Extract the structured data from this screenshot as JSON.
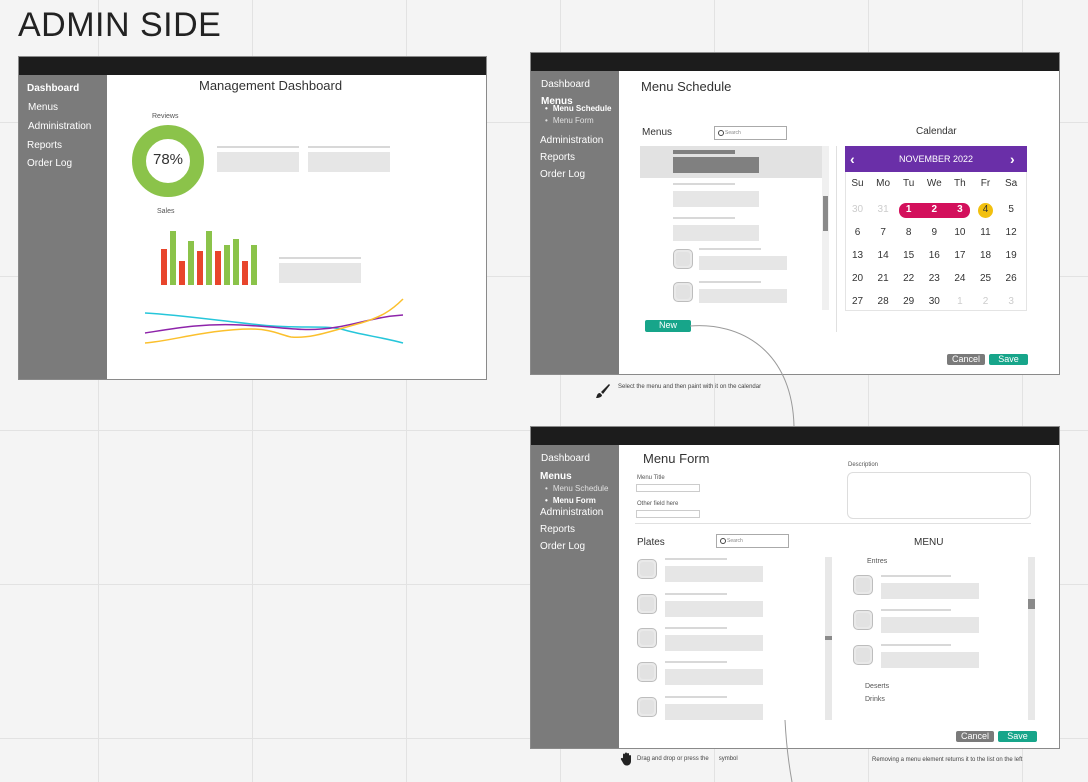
{
  "page_title": "ADMIN SIDE",
  "dashboard": {
    "nav": [
      "Dashboard",
      "Menus",
      "Administration",
      "Reports",
      "Order Log"
    ],
    "heading": "Management Dashboard",
    "reviews_label": "Reviews",
    "reviews_value": "78%",
    "reviews_fraction": 0.78,
    "sales_label": "Sales",
    "colors": {
      "green": "#8bc34a",
      "red": "#e8452c",
      "purple": "#8e24aa",
      "cyan": "#26c6da",
      "yellow": "#fbc02d"
    }
  },
  "schedule": {
    "nav": [
      "Dashboard",
      "Menus",
      "Administration",
      "Reports",
      "Order Log"
    ],
    "sub_nav": [
      "Menu Schedule",
      "Menu Form"
    ],
    "heading": "Menu Schedule",
    "menus_label": "Menus",
    "search_placeholder": "Search",
    "calendar_label": "Calendar",
    "month": "NOVEMBER 2022",
    "weekdays": [
      "Su",
      "Mo",
      "Tu",
      "We",
      "Th",
      "Fr",
      "Sa"
    ],
    "weeks": [
      [
        "30",
        "31",
        "1",
        "2",
        "3",
        "4",
        "5"
      ],
      [
        "6",
        "7",
        "8",
        "9",
        "10",
        "11",
        "12"
      ],
      [
        "13",
        "14",
        "15",
        "16",
        "17",
        "18",
        "19"
      ],
      [
        "20",
        "21",
        "22",
        "23",
        "24",
        "25",
        "26"
      ],
      [
        "27",
        "28",
        "29",
        "30",
        "1",
        "2",
        "3"
      ]
    ],
    "new_button": "New",
    "cancel_button": "Cancel",
    "save_button": "Save",
    "note": "Select the menu and then paint with it on the calendar",
    "colors": {
      "header": "#6a2fa8",
      "selected": "#d3105c",
      "today": "#f2c00f"
    }
  },
  "form": {
    "nav": [
      "Dashboard",
      "Menus",
      "Administration",
      "Reports",
      "Order Log"
    ],
    "sub_nav": [
      "Menu Schedule",
      "Menu Form"
    ],
    "heading": "Menu Form",
    "menu_title_label": "Menu Title",
    "other_field_label": "Other field here",
    "description_label": "Description",
    "plates_label": "Plates",
    "search_placeholder": "Search",
    "menu_label": "MENU",
    "entres_label": "Entres",
    "deserts_label": "Deserts",
    "drinks_label": "Drinks",
    "cancel_button": "Cancel",
    "save_button": "Save",
    "drag_note": "Drag and drop or press the      symbol",
    "remove_note": "Removing a menu element returns it to the list on the left"
  }
}
